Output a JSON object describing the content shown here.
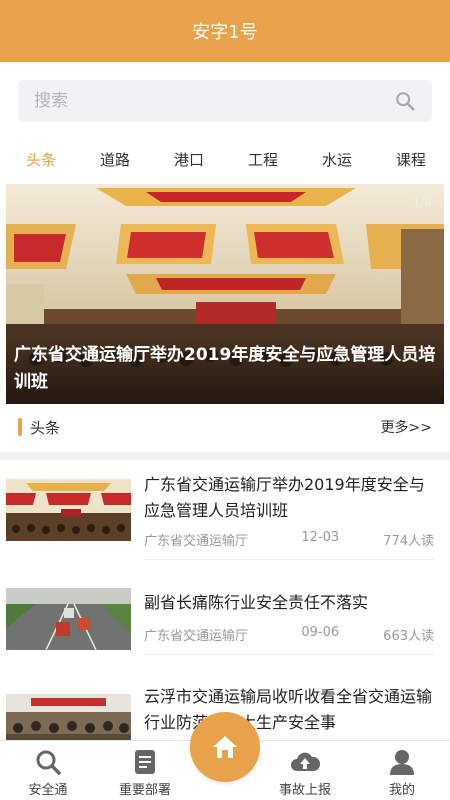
{
  "header": {
    "title": "安字1号"
  },
  "search": {
    "placeholder": "搜索"
  },
  "tabs": [
    {
      "label": "头条",
      "active": true
    },
    {
      "label": "道路",
      "active": false
    },
    {
      "label": "港口",
      "active": false
    },
    {
      "label": "工程",
      "active": false
    },
    {
      "label": "水运",
      "active": false
    },
    {
      "label": "课程",
      "active": false
    }
  ],
  "banner": {
    "counter": "1/4",
    "caption": "广东省交通运输厅举办2019年度安全与应急管理人员培训班"
  },
  "section": {
    "label": "头条",
    "more": "更多>>"
  },
  "news": [
    {
      "title": "广东省交通运输厅举办2019年度安全与应急管理人员培训班",
      "source": "广东省交通运输厅",
      "date": "12-03",
      "reads": "774人读"
    },
    {
      "title": "副省长痛陈行业安全责任不落实",
      "source": "广东省交通运输厅",
      "date": "09-06",
      "reads": "663人读"
    },
    {
      "title": "云浮市交通运输局收听收看全省交通运输行业防范重特大生产安全事",
      "source": "",
      "date": "",
      "reads": ""
    }
  ],
  "bottom_nav": [
    {
      "label": "安全通",
      "icon": "search-icon"
    },
    {
      "label": "重要部署",
      "icon": "document-icon"
    },
    {
      "label": "事故上报",
      "icon": "cloud-upload-icon"
    },
    {
      "label": "我的",
      "icon": "user-icon"
    }
  ],
  "home_button": {
    "icon": "home-icon"
  },
  "colors": {
    "accent": "#E8A24A",
    "muted": "#999999"
  }
}
